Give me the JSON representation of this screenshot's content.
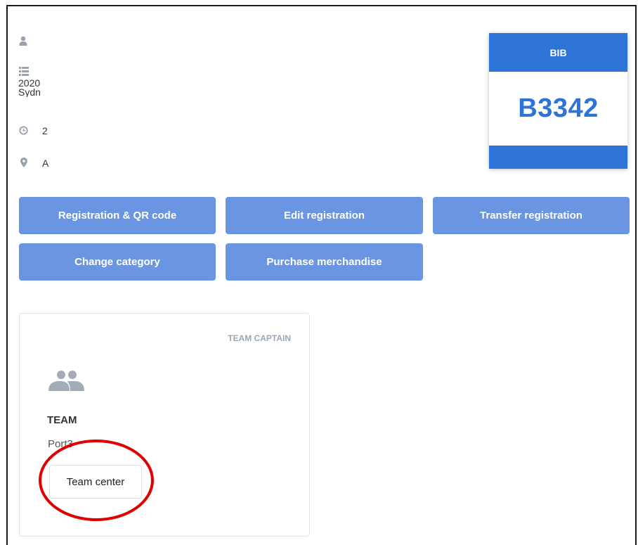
{
  "event": {
    "date_line": "2020",
    "location_line": "Sydn",
    "time_value": "2",
    "address_value": "A"
  },
  "bib": {
    "label": "BIB",
    "number": "B3342"
  },
  "actions": {
    "registration_qr": "Registration & QR code",
    "edit_registration": "Edit registration",
    "transfer_registration": "Transfer registration",
    "change_category": "Change category",
    "purchase_merchandise": "Purchase merchandise"
  },
  "team": {
    "role_badge": "TEAM CAPTAIN",
    "label": "TEAM",
    "name": "Port3",
    "center_button": "Team center"
  },
  "colors": {
    "primary": "#2e74d6",
    "button": "#6a95e3",
    "annotation": "#e00000"
  },
  "icons": [
    "user-icon",
    "list-icon",
    "clock-icon",
    "map-pin-icon",
    "team-icon"
  ]
}
